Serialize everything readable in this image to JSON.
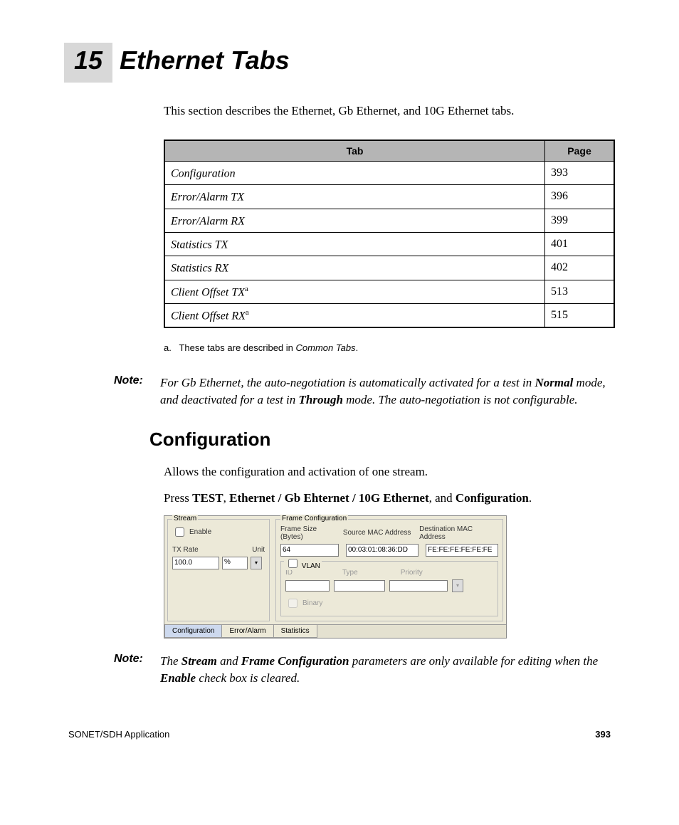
{
  "chapter": {
    "number": "15",
    "title": "Ethernet Tabs"
  },
  "intro": "This section describes the Ethernet, Gb Ethernet, and 10G Ethernet tabs.",
  "table": {
    "headers": {
      "tab": "Tab",
      "page": "Page"
    },
    "rows": [
      {
        "tab": "Configuration",
        "sup": "",
        "page": "393"
      },
      {
        "tab": "Error/Alarm TX",
        "sup": "",
        "page": "396"
      },
      {
        "tab": "Error/Alarm RX",
        "sup": "",
        "page": "399"
      },
      {
        "tab": "Statistics TX",
        "sup": "",
        "page": "401"
      },
      {
        "tab": "Statistics RX",
        "sup": "",
        "page": "402"
      },
      {
        "tab": "Client Offset TX",
        "sup": "a",
        "page": "513"
      },
      {
        "tab": "Client Offset RX",
        "sup": "a",
        "page": "515"
      }
    ],
    "footnote_label": "a.",
    "footnote_text": "These tabs are described in Common Tabs."
  },
  "note1": {
    "label": "Note:",
    "t1": "For Gb Ethernet, the auto-negotiation is automatically activated for a test in ",
    "b1": "Normal",
    "t2": " mode, and deactivated for a test in ",
    "b2": "Through",
    "t3": " mode. The auto-negotiation is not configurable."
  },
  "section_heading": "Configuration",
  "para1": "Allows the configuration and activation of one stream.",
  "para2": {
    "t1": "Press ",
    "b1": "TEST",
    "t2": ", ",
    "b2": "Ethernet / Gb Ehternet / 10G Ethernet",
    "t3": ", and ",
    "b3": "Configuration",
    "t4": "."
  },
  "screenshot": {
    "stream": {
      "legend": "Stream",
      "enable": "Enable",
      "txrate_label": "TX Rate",
      "unit_label": "Unit",
      "txrate_value": "100.0",
      "unit_value": "%"
    },
    "frame": {
      "legend": "Frame Configuration",
      "size_label": "Frame Size (Bytes)",
      "src_label": "Source MAC Address",
      "dst_label": "Destination MAC Address",
      "size_value": "64",
      "src_value": "00:03:01:08:36:DD",
      "dst_value": "FE:FE:FE:FE:FE:FE",
      "vlan_legend": "VLAN",
      "id_label": "ID",
      "type_label": "Type",
      "priority_label": "Priority",
      "binary_label": "Binary"
    },
    "tabs": {
      "configuration": "Configuration",
      "error_alarm": "Error/Alarm",
      "statistics": "Statistics"
    }
  },
  "note2": {
    "label": "Note:",
    "t1": "The ",
    "b1": "Stream",
    "t2": " and ",
    "b2": "Frame Configuration",
    "t3": " parameters are only available for editing when the ",
    "b3": "Enable",
    "t4": " check box is cleared."
  },
  "footer": {
    "left": "SONET/SDH Application",
    "right": "393"
  }
}
